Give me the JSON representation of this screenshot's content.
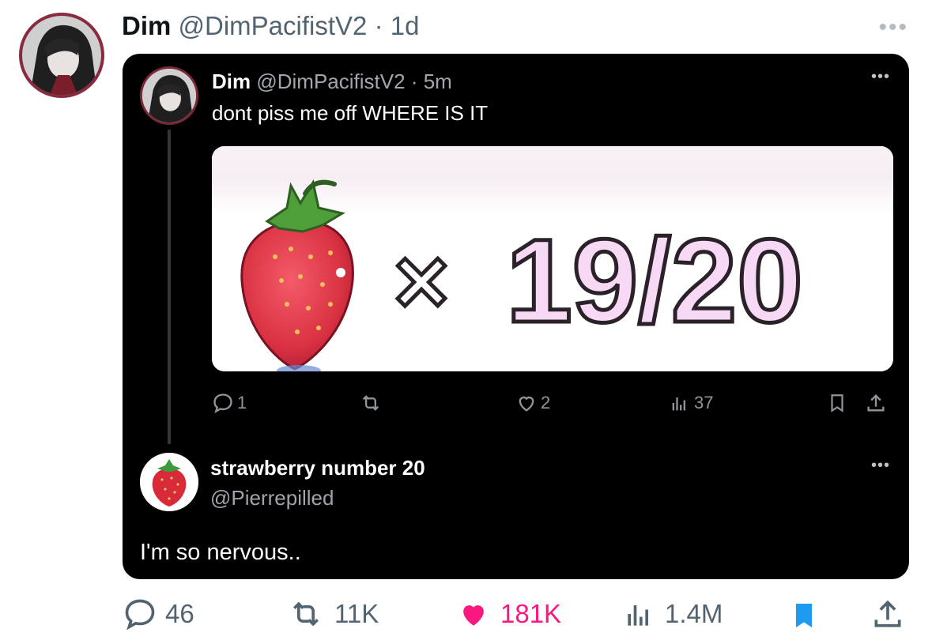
{
  "post": {
    "author_name": "Dim",
    "author_handle": "@DimPacifistV2",
    "separator": "·",
    "time": "1d",
    "more": "•••"
  },
  "quoted": {
    "author_name": "Dim",
    "author_handle": "@DimPacifistV2",
    "separator": "·",
    "time": "5m",
    "text": "dont piss me off WHERE IS IT",
    "more": "•••",
    "media": {
      "counter_text": "19/20",
      "multiplier": "×"
    },
    "metrics": {
      "replies": "1",
      "likes": "2",
      "views": "37"
    }
  },
  "reply": {
    "author_name": "strawberry number 20",
    "author_handle": "@Pierrepilled",
    "text": "I'm so nervous..",
    "more": "•••"
  },
  "metrics": {
    "replies": "46",
    "reposts": "11K",
    "likes": "181K",
    "views": "1.4M"
  },
  "colors": {
    "like_active": "#f91880",
    "bookmark_active": "#1d9bf0",
    "card_bg": "#000000"
  }
}
